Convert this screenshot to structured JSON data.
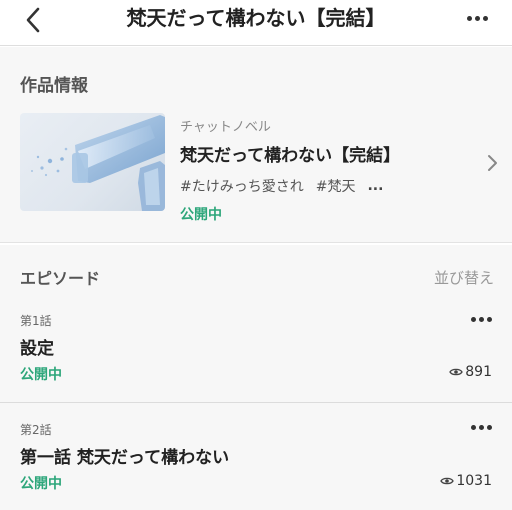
{
  "header": {
    "back_icon": "chevron-left-icon",
    "title": "梵天だって構わない【完結】",
    "more_icon": "more-horizontal-icon"
  },
  "work_info": {
    "heading": "作品情報",
    "type": "チャットノベル",
    "title": "梵天だって構わない【完結】",
    "tags": [
      "#たけみっち愛され",
      "#梵天"
    ],
    "tags_more": "...",
    "status": "公開中",
    "chevron_icon": "chevron-right-icon"
  },
  "episodes": {
    "heading": "エピソード",
    "sort_label": "並び替え",
    "items": [
      {
        "number": "第1話",
        "title": "設定",
        "status": "公開中",
        "views": "891"
      },
      {
        "number": "第2話",
        "title": "第一話 梵天だって構わない",
        "status": "公開中",
        "views": "1031"
      }
    ]
  },
  "colors": {
    "accent_green": "#2da67a",
    "section_bg": "#f7f7f7",
    "text_primary": "#222222",
    "text_muted": "#888888"
  }
}
